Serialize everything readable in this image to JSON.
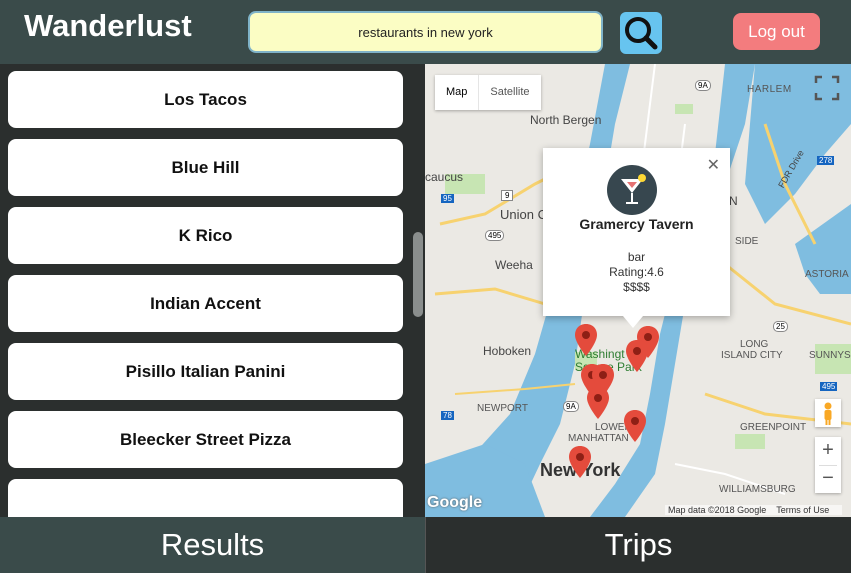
{
  "app": {
    "title": "Wanderlust"
  },
  "search": {
    "value": "restaurants in new york"
  },
  "header": {
    "logout_label": "Log out"
  },
  "results": [
    "Los Tacos",
    "Blue Hill",
    "K Rico",
    "Indian Accent",
    "Pisillo Italian Panini",
    "Bleecker Street Pizza"
  ],
  "map": {
    "type_map": "Map",
    "type_satellite": "Satellite",
    "zoom_in": "+",
    "zoom_out": "−",
    "attribution_data": "Map data ©2018 Google",
    "attribution_terms": "Terms of Use",
    "google_logo": "Google",
    "labels": {
      "harlem": "HARLEM",
      "north_bergen": "North Bergen",
      "secaucus": "caucus",
      "union_city": "Union C",
      "weehawken": "Weeha",
      "hoboken": "Hoboken",
      "washington_sq": "Washingt",
      "sq_park": "Square Park",
      "newport": "NEWPORT",
      "lower_manhattan_1": "LOWER",
      "lower_manhattan_2": "MANHATTAN",
      "new_york": "New York",
      "long_island_city_1": "LONG",
      "long_island_city_2": "ISLAND CITY",
      "sunnyside": "SUNNYSI",
      "astoria": "ASTORIA",
      "greenpoint": "GREENPOINT",
      "williamsburg": "WILLIAMSBURG",
      "fdr_drive": "FDR Drive",
      "side": "SIDE",
      "n_label": "N",
      "route_9a": "9A",
      "route_9a_2": "9A",
      "route_9": "9",
      "route_95": "95",
      "route_495": "495",
      "route_278": "278",
      "route_25": "25",
      "route_495b": "495",
      "route_78": "78",
      "route_278b": "278"
    },
    "info_window": {
      "name": "Gramercy Tavern",
      "type": "bar",
      "rating": "Rating:4.6",
      "price": "$$$$"
    }
  },
  "tabs": {
    "results": "Results",
    "trips": "Trips"
  },
  "colors": {
    "header_bg": "#3a4b4a",
    "search_bg": "#fbfdc4",
    "search_btn": "#67c4ef",
    "logout": "#f37c7e",
    "water": "#7fbde0",
    "pin": "#e44b3c"
  }
}
